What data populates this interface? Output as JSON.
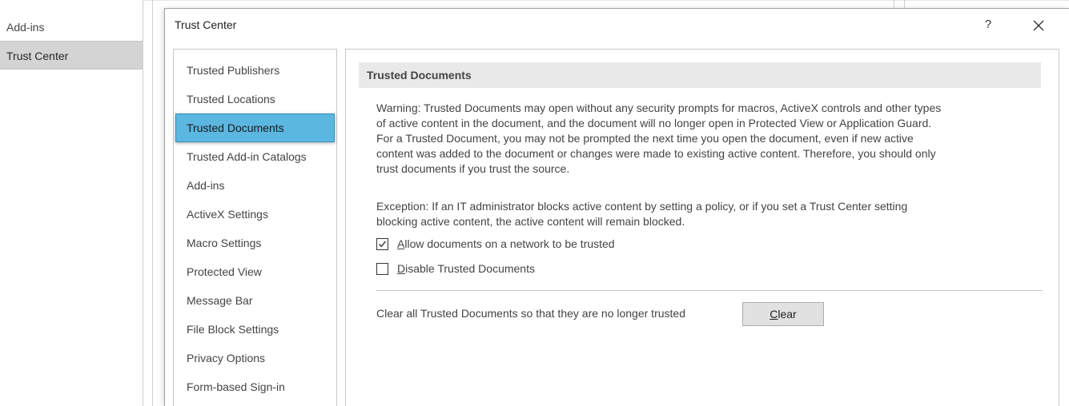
{
  "background_nav": {
    "items": [
      {
        "label": "Add-ins"
      },
      {
        "label": "Trust Center"
      }
    ]
  },
  "dialog": {
    "title": "Trust Center",
    "help_label": "?",
    "close_icon": "close-icon"
  },
  "categories": [
    {
      "label": "Trusted Publishers"
    },
    {
      "label": "Trusted Locations"
    },
    {
      "label": "Trusted Documents"
    },
    {
      "label": "Trusted Add-in Catalogs"
    },
    {
      "label": "Add-ins"
    },
    {
      "label": "ActiveX Settings"
    },
    {
      "label": "Macro Settings"
    },
    {
      "label": "Protected View"
    },
    {
      "label": "Message Bar"
    },
    {
      "label": "File Block Settings"
    },
    {
      "label": "Privacy Options"
    },
    {
      "label": "Form-based Sign-in"
    }
  ],
  "selected_category": "Trusted Documents",
  "content": {
    "section_title": "Trusted Documents",
    "warning_lines": [
      "Warning: Trusted Documents may open without any security prompts for macros, ActiveX controls and other types",
      "of active content in the document, and the document will no longer open in Protected View or Application Guard.",
      "For a Trusted Document, you may not be prompted the next time you open the document, even if new active",
      "content was added to the document or changes were made to existing active content. Therefore, you should only",
      "trust documents if you trust the source."
    ],
    "exception_lines": [
      "Exception: If an IT administrator blocks active content by setting a policy, or if you set a Trust Center setting",
      "blocking active content, the active content will remain blocked."
    ],
    "checkbox_allow_network": {
      "accel": "A",
      "rest": "llow documents on a network to be trusted",
      "checked": true
    },
    "checkbox_disable": {
      "accel": "D",
      "rest": "isable Trusted Documents",
      "checked": false
    },
    "clear_description": "Clear all Trusted Documents so that they are no longer trusted",
    "clear_button": {
      "accel": "C",
      "rest": "lear"
    }
  },
  "colors": {
    "selected_category_bg": "#5bb6e0",
    "section_header_bg": "#e9e9e9"
  }
}
